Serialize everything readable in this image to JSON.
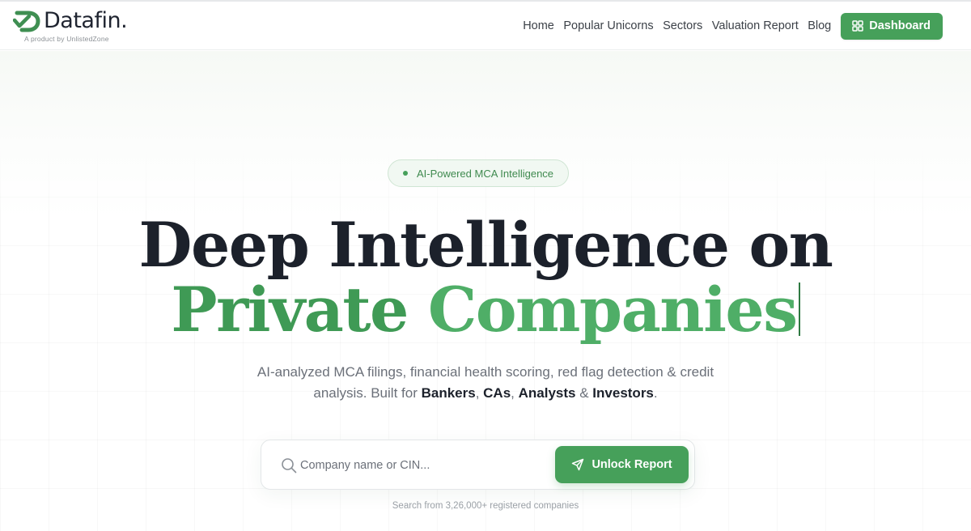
{
  "brand": {
    "name": "Datafin.",
    "tagline": "A product by UnlistedZone",
    "accent": "#46a05a"
  },
  "nav": {
    "items": [
      {
        "label": "Home"
      },
      {
        "label": "Popular Unicorns"
      },
      {
        "label": "Sectors"
      },
      {
        "label": "Valuation Report"
      },
      {
        "label": "Blog"
      }
    ],
    "dashboard_label": "Dashboard",
    "dashboard_icon": "grid-icon"
  },
  "hero": {
    "badge": "AI-Powered MCA Intelligence",
    "headline_line1": "Deep Intelligence on",
    "headline_word1": "Private",
    "headline_word2": "Companies",
    "subtitle_lead": "AI-analyzed MCA filings, financial health scoring, red flag detection & credit analysis. Built for ",
    "audience": [
      "Bankers",
      "CAs",
      "Analysts",
      "Investors"
    ],
    "sep1": ", ",
    "sep2": ", ",
    "sep3": " & ",
    "end": ".",
    "headline_dark_color": "#1c212b",
    "headline_green_color": "#4fae67"
  },
  "search": {
    "placeholder": "Company name or CIN...",
    "value": "",
    "button_label": "Unlock Report",
    "button_icon": "send-icon",
    "note": "Search from 3,26,000+ registered companies"
  }
}
